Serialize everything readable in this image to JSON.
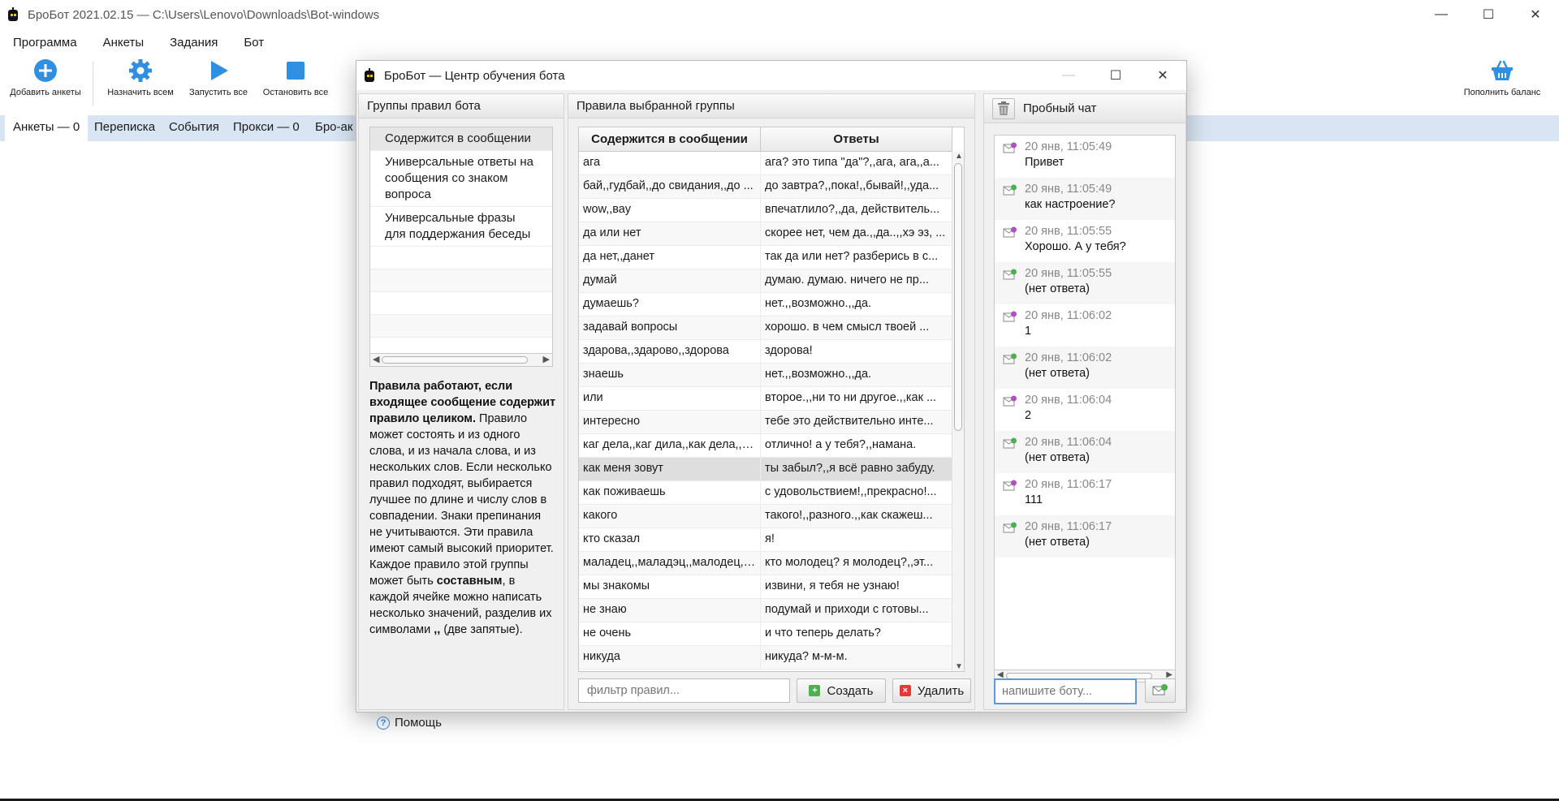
{
  "app": {
    "title": "БроБот 2021.02.15 — C:\\Users\\Lenovo\\Downloads\\Bot-windows",
    "menu": [
      "Программа",
      "Анкеты",
      "Задания",
      "Бот"
    ],
    "toolbar": {
      "add_profiles": "Добавить анкеты",
      "assign_all": "Назначить всем",
      "start_all": "Запустить все",
      "stop_all": "Остановить все",
      "top_up": "Пополнить баланс"
    },
    "tabs": [
      "Анкеты — 0",
      "Переписка",
      "События",
      "Прокси — 0",
      "Бро-ак"
    ],
    "accent_color": "#2f8fe0"
  },
  "dialog": {
    "title": "БроБот — Центр обучения бота",
    "groups_panel": {
      "header": "Группы правил бота",
      "groups": [
        "Содержится в сообщении",
        "Универсальные ответы на сообщения со знаком вопроса",
        "Универсальные фразы для поддержания беседы"
      ],
      "help_bold": "Правила работают, если входящее сообщение содержит правило целиком.",
      "help_text": " Правило может состоять и из одного слова, и из начала слова, и из нескольких слов. Если несколько правил подходят, выбирается лучшее по длине и числу слов в совпадении. Знаки препинания не учитываются. Эти правила имеют самый высокий приоритет.",
      "help_text2_a": "Каждое правило этой группы может быть ",
      "help_text2_bold": "составным",
      "help_text2_b": ", в каждой ячейке можно написать несколько значений, разделив их символами ",
      "help_text2_sep": ",,",
      "help_text2_c": " (две запятые).",
      "help_button": "Помощь"
    },
    "rules_panel": {
      "header": "Правила выбранной группы",
      "columns": [
        "Содержится в сообщении",
        "Ответы"
      ],
      "rows": [
        [
          "ага",
          "ага? это типа \"да\"?,,ага, ага,,а..."
        ],
        [
          "бай,,гудбай,,до свидания,,до ...",
          "до завтра?,,пока!,,бывай!,,уда..."
        ],
        [
          "wow,,вау",
          "впечатлило?,,да, действитель..."
        ],
        [
          "да или нет",
          "скорее нет, чем да.,,да..,,хэ эз, ..."
        ],
        [
          "да нет,,данет",
          "так да или нет? разберись в с..."
        ],
        [
          "думай",
          "думаю. думаю. ничего не пр..."
        ],
        [
          "думаешь?",
          "нет.,,возможно.,,да."
        ],
        [
          "задавай вопросы",
          "хорошо. в чем смысл твоей ..."
        ],
        [
          "здарова,,здарово,,здорова",
          "здорова!"
        ],
        [
          "знаешь",
          "нет.,,возможно.,,да."
        ],
        [
          "или",
          "второе.,,ни то ни другое.,,как ..."
        ],
        [
          "интересно",
          "тебе это действительно инте..."
        ],
        [
          "каг дела,,каг дила,,как дела,,к...",
          "отлично! а у тебя?,,намана."
        ],
        [
          "как меня зовут",
          "ты забыл?,,я всё равно забуду."
        ],
        [
          "как поживаешь",
          "с удовольствием!,,прекрасно!..."
        ],
        [
          "какого",
          "такого!,,разного.,,как скажеш..."
        ],
        [
          "кто сказал",
          "я!"
        ],
        [
          "маладец,,маладэц,,малодец,,...",
          "кто молодец? я молодец?,,эт..."
        ],
        [
          "мы знакомы",
          "извини, я тебя не узнаю!"
        ],
        [
          "не знаю",
          "подумай и приходи с готовы..."
        ],
        [
          "не очень",
          "и что теперь делать?"
        ],
        [
          "никуда",
          "никуда? м-м-м."
        ]
      ],
      "selected_row": 13,
      "filter_placeholder": "фильтр правил...",
      "create_button": "Создать",
      "delete_button": "Удалить"
    },
    "chat_panel": {
      "header": "Пробный чат",
      "messages": [
        {
          "time": "20 янв, 11:05:49",
          "text": "Привет",
          "dir": "in"
        },
        {
          "time": "20 янв, 11:05:49",
          "text": "как настроение?",
          "dir": "out"
        },
        {
          "time": "20 янв, 11:05:55",
          "text": "Хорошо. А у тебя?",
          "dir": "in"
        },
        {
          "time": "20 янв, 11:05:55",
          "text": "(нет ответа)",
          "dir": "out"
        },
        {
          "time": "20 янв, 11:06:02",
          "text": "1",
          "dir": "in"
        },
        {
          "time": "20 янв, 11:06:02",
          "text": "(нет ответа)",
          "dir": "out"
        },
        {
          "time": "20 янв, 11:06:04",
          "text": "2",
          "dir": "in"
        },
        {
          "time": "20 янв, 11:06:04",
          "text": "(нет ответа)",
          "dir": "out"
        },
        {
          "time": "20 янв, 11:06:17",
          "text": "111",
          "dir": "in"
        },
        {
          "time": "20 янв, 11:06:17",
          "text": "(нет ответа)",
          "dir": "out"
        }
      ],
      "input_placeholder": "напишите боту..."
    }
  }
}
